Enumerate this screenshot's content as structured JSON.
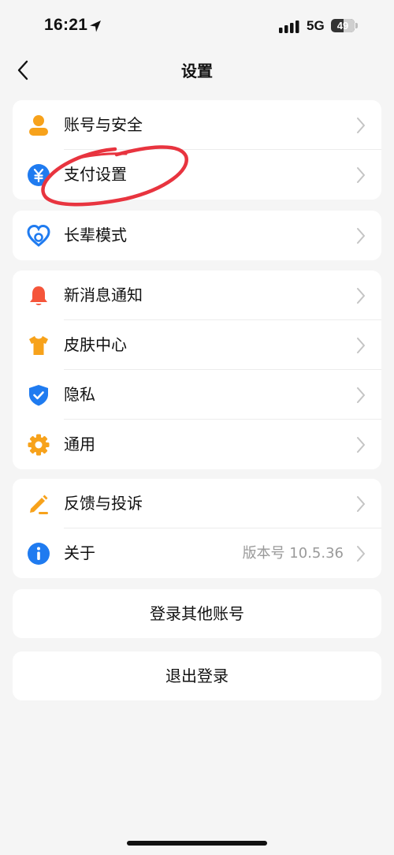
{
  "status_bar": {
    "time": "16:21",
    "network": "5G",
    "battery": "49"
  },
  "nav": {
    "title": "设置"
  },
  "groups": [
    {
      "items": [
        {
          "label": "账号与安全",
          "icon": "user-icon"
        },
        {
          "label": "支付设置",
          "icon": "yuan-icon"
        }
      ]
    },
    {
      "items": [
        {
          "label": "长辈模式",
          "icon": "heart-icon"
        }
      ]
    },
    {
      "items": [
        {
          "label": "新消息通知",
          "icon": "bell-icon"
        },
        {
          "label": "皮肤中心",
          "icon": "tshirt-icon"
        },
        {
          "label": "隐私",
          "icon": "shield-icon"
        },
        {
          "label": "通用",
          "icon": "gear-icon"
        }
      ]
    },
    {
      "items": [
        {
          "label": "反馈与投诉",
          "icon": "pencil-icon"
        },
        {
          "label": "关于",
          "icon": "info-icon",
          "value": "版本号 10.5.36"
        }
      ]
    }
  ],
  "actions": {
    "switch_account": "登录其他账号",
    "logout": "退出登录"
  },
  "colors": {
    "orange": "#f7a21b",
    "blue": "#1f7bf0",
    "red_bell": "#f5553a",
    "annotation_red": "#e8343f"
  }
}
